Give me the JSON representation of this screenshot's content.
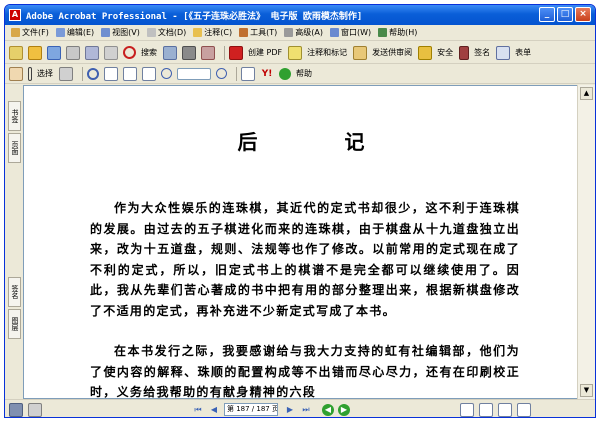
{
  "window": {
    "title": "Adobe Acrobat Professional - [《五子连珠必胜法》 电子版    欧雨模杰制作]"
  },
  "menu": [
    {
      "label": "文件(F)",
      "color": "#d8a848"
    },
    {
      "label": "编辑(E)",
      "color": "#7a9ad8"
    },
    {
      "label": "视图(V)",
      "color": "#6f8fd0"
    },
    {
      "label": "文档(D)",
      "color": "#c0c0c0"
    },
    {
      "label": "注释(C)",
      "color": "#e8c050"
    },
    {
      "label": "工具(T)",
      "color": "#c07030"
    },
    {
      "label": "高级(A)",
      "color": "#9a9a9a"
    },
    {
      "label": "窗口(W)",
      "color": "#6a8ad0"
    },
    {
      "label": "帮助(H)",
      "color": "#4a8a4a"
    }
  ],
  "toolbar1": {
    "find_label": "搜索",
    "create_pdf": "创建 PDF",
    "comment": "注释和标记",
    "send_review": "发送供审阅",
    "secure": "安全",
    "sign": "签名",
    "forms": "表单"
  },
  "toolbar2": {
    "select_label": "选择",
    "help_label": "帮助"
  },
  "side_tabs": {
    "bookmarks": "书签",
    "pages": "页面",
    "signatures": "签名",
    "layers": "图层"
  },
  "document": {
    "title": "后  记",
    "paragraphs": [
      "作为大众性娱乐的连珠棋，其近代的定式书却很少，这不利于连珠棋的发展。由过去的五子棋进化而来的连珠棋，由于棋盘从十九道盘独立出来，改为十五道盘，规则、法规等也作了修改。以前常用的定式现在成了不利的定式，所以，旧定式书上的棋谱不是完全都可以继续使用了。因此，我从先辈们苦心著成的书中把有用的部分整理出来，根据新棋盘修改了不适用的定式，再补充进不少新定式写成了本书。",
      "在本书发行之际，我要感谢给与我大力支持的虹有社编辑部，他们为了使内容的解释、珠顺的配置构成等不出错而尽心尽力，还有在印刷校正时，义务给我帮助的有献身精神的六段"
    ]
  },
  "status": {
    "page": "第 187 / 187 页"
  }
}
